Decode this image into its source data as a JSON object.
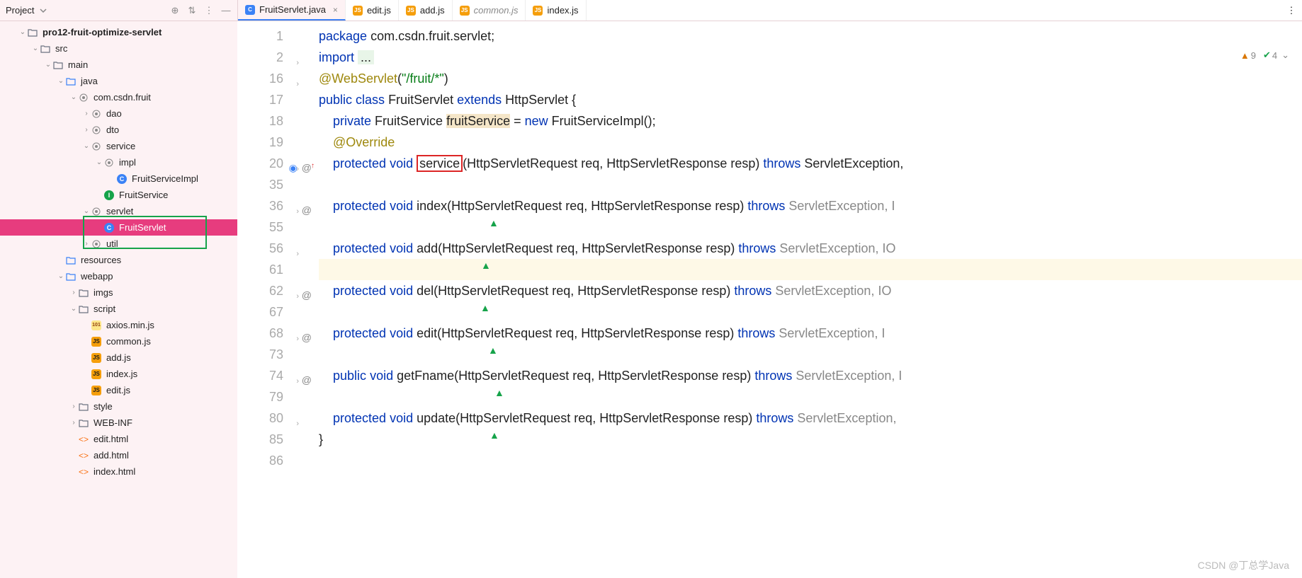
{
  "projectHeader": {
    "title": "Project"
  },
  "tabs": [
    {
      "label": "FruitServlet.java",
      "icon": "C",
      "cls": "ic-c",
      "active": true,
      "close": true
    },
    {
      "label": "edit.js",
      "icon": "JS",
      "cls": "ic-js",
      "dim": true
    },
    {
      "label": "add.js",
      "icon": "JS",
      "cls": "ic-js",
      "dim": true
    },
    {
      "label": "common.js",
      "icon": "JS",
      "cls": "ic-js",
      "dim": true,
      "italic": true
    },
    {
      "label": "index.js",
      "icon": "JS",
      "cls": "ic-js",
      "dim": true
    }
  ],
  "tree": [
    {
      "indent": 1,
      "chev": "v",
      "ico": "mod",
      "name": "pro12-fruit-optimize-servlet",
      "bold": true
    },
    {
      "indent": 2,
      "chev": "v",
      "ico": "fld",
      "name": "src"
    },
    {
      "indent": 3,
      "chev": "v",
      "ico": "fld",
      "name": "main"
    },
    {
      "indent": 4,
      "chev": "v",
      "ico": "fsrc",
      "name": "java"
    },
    {
      "indent": 5,
      "chev": "v",
      "ico": "pkg",
      "name": "com.csdn.fruit"
    },
    {
      "indent": 6,
      "chev": ">",
      "ico": "pkg",
      "name": "dao"
    },
    {
      "indent": 6,
      "chev": ">",
      "ico": "pkg",
      "name": "dto"
    },
    {
      "indent": 6,
      "chev": "v",
      "ico": "pkg",
      "name": "service"
    },
    {
      "indent": 7,
      "chev": "v",
      "ico": "pkg",
      "name": "impl"
    },
    {
      "indent": 8,
      "chev": "",
      "ico": "cls",
      "name": "FruitServiceImpl"
    },
    {
      "indent": 7,
      "chev": "",
      "ico": "int",
      "name": "FruitService"
    },
    {
      "indent": 6,
      "chev": "v",
      "ico": "pkg",
      "name": "servlet"
    },
    {
      "indent": 7,
      "chev": "",
      "ico": "cls",
      "name": "FruitServlet",
      "sel": true
    },
    {
      "indent": 6,
      "chev": ">",
      "ico": "pkg",
      "name": "util"
    },
    {
      "indent": 4,
      "chev": "",
      "ico": "res",
      "name": "resources"
    },
    {
      "indent": 4,
      "chev": "v",
      "ico": "web",
      "name": "webapp"
    },
    {
      "indent": 5,
      "chev": ">",
      "ico": "fld",
      "name": "imgs"
    },
    {
      "indent": 5,
      "chev": "v",
      "ico": "fld",
      "name": "script"
    },
    {
      "indent": 6,
      "chev": "",
      "ico": "jsmin",
      "name": "axios.min.js"
    },
    {
      "indent": 6,
      "chev": "",
      "ico": "js",
      "name": "common.js"
    },
    {
      "indent": 6,
      "chev": "",
      "ico": "js",
      "name": "add.js"
    },
    {
      "indent": 6,
      "chev": "",
      "ico": "js",
      "name": "index.js"
    },
    {
      "indent": 6,
      "chev": "",
      "ico": "js",
      "name": "edit.js"
    },
    {
      "indent": 5,
      "chev": ">",
      "ico": "fld",
      "name": "style"
    },
    {
      "indent": 5,
      "chev": ">",
      "ico": "fld",
      "name": "WEB-INF"
    },
    {
      "indent": 5,
      "chev": "",
      "ico": "html",
      "name": "edit.html"
    },
    {
      "indent": 5,
      "chev": "",
      "ico": "html",
      "name": "add.html"
    },
    {
      "indent": 5,
      "chev": "",
      "ico": "html",
      "name": "index.html"
    }
  ],
  "lineNumbers": [
    "1",
    "2",
    "16",
    "17",
    "18",
    "19",
    "20",
    "35",
    "36",
    "55",
    "56",
    "61",
    "62",
    "67",
    "68",
    "73",
    "74",
    "79",
    "80",
    "85",
    "86"
  ],
  "gutterIcons": {
    "6": "ovr",
    "8": "at",
    "12": "at",
    "14": "at",
    "16": "at"
  },
  "folds": [
    "1",
    "2"
  ],
  "code": {
    "l0": "package com.csdn.fruit.servlet;",
    "l1a": "import ",
    "l1b": "...",
    "l2a": "@WebServlet",
    "l2b": "(\"/fruit/*\")",
    "l3": "public class FruitServlet extends HttpServlet {",
    "l4a": "    private ",
    "l4b": "FruitService ",
    "l4c": "fruitService",
    "l4d": " = new FruitServiceImpl();",
    "l5": "    @Override",
    "l6a": "    protected void ",
    "l6b": "service",
    "l6c": "(HttpServletRequest req, HttpServletResponse resp) throws ServletException,",
    "l8": "    protected void index(HttpServletRequest req, HttpServletResponse resp) throws ServletException, I",
    "l10": "    protected void add(HttpServletRequest req, HttpServletResponse resp) throws ServletException, IO",
    "l12": "    protected void del(HttpServletRequest req, HttpServletResponse resp) throws ServletException, IO",
    "l14": "    protected void edit(HttpServletRequest req, HttpServletResponse resp) throws ServletException, I",
    "l16": "    public void getFname(HttpServletRequest req, HttpServletResponse resp) throws ServletException, I",
    "l18": "    protected void update(HttpServletRequest req, HttpServletResponse resp) throws ServletException,",
    "l19": "}"
  },
  "badges": {
    "warn": "9",
    "ok": "4"
  },
  "arrowsX": [
    240,
    229,
    228,
    239,
    248,
    241
  ],
  "watermark": "CSDN @丁总学Java"
}
